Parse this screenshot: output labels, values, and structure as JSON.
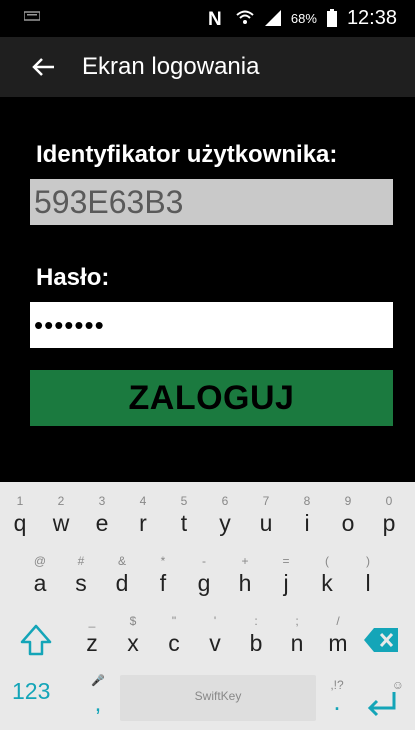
{
  "status_bar": {
    "battery_text": "68%",
    "time": "12:38",
    "icons": [
      "notification-icon",
      "nfc-icon",
      "wifi-icon",
      "signal-icon",
      "battery-icon"
    ]
  },
  "app_bar": {
    "title": "Ekran logowania",
    "back_icon": "arrow-left-icon"
  },
  "form": {
    "user_label": "Identyfikator użytkownika:",
    "user_value": "593E63B3",
    "password_label": "Hasło:",
    "password_value": "•••••••",
    "login_button": "ZALOGUJ",
    "login_button_color": "#1b7a3f"
  },
  "keyboard": {
    "row1": [
      {
        "hint": "1",
        "key": "q"
      },
      {
        "hint": "2",
        "key": "w"
      },
      {
        "hint": "3",
        "key": "e"
      },
      {
        "hint": "4",
        "key": "r"
      },
      {
        "hint": "5",
        "key": "t"
      },
      {
        "hint": "6",
        "key": "y"
      },
      {
        "hint": "7",
        "key": "u"
      },
      {
        "hint": "8",
        "key": "i"
      },
      {
        "hint": "9",
        "key": "o"
      },
      {
        "hint": "0",
        "key": "p"
      }
    ],
    "row2": [
      {
        "hint": "@",
        "key": "a"
      },
      {
        "hint": "#",
        "key": "s"
      },
      {
        "hint": "&",
        "key": "d"
      },
      {
        "hint": "*",
        "key": "f"
      },
      {
        "hint": "-",
        "key": "g"
      },
      {
        "hint": "+",
        "key": "h"
      },
      {
        "hint": "=",
        "key": "j"
      },
      {
        "hint": "(",
        "key": "k"
      },
      {
        "hint": ")",
        "key": "l"
      }
    ],
    "row3": [
      {
        "hint": "_",
        "key": "z"
      },
      {
        "hint": "$",
        "key": "x"
      },
      {
        "hint": "\"",
        "key": "c"
      },
      {
        "hint": "'",
        "key": "v"
      },
      {
        "hint": ":",
        "key": "b"
      },
      {
        "hint": ";",
        "key": "n"
      },
      {
        "hint": "/",
        "key": "m"
      }
    ],
    "num_key": "123",
    "comma_key": ",",
    "comma_hint": "🎤",
    "space_brand": "SwiftKey",
    "period_key": ".",
    "period_hint": ",!?",
    "enter_hint": "☺",
    "accent_color": "#14a5b8"
  }
}
